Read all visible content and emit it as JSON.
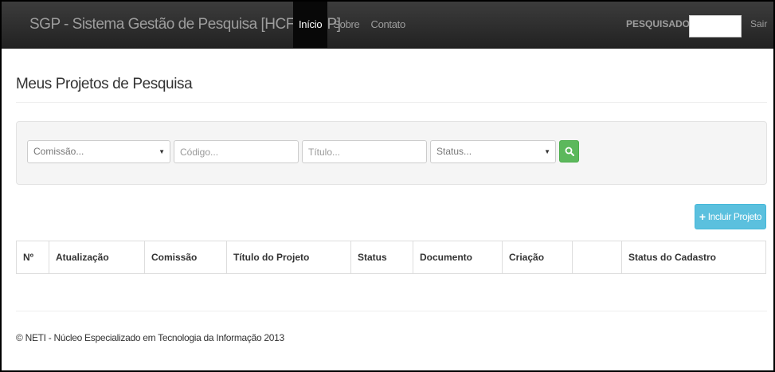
{
  "navbar": {
    "brand": "SGP - Sistema Gestão de Pesquisa [HCFMUSP]",
    "links": [
      {
        "label": "Início",
        "active": true
      },
      {
        "label": "Sobre",
        "active": false
      },
      {
        "label": "Contato",
        "active": false
      }
    ],
    "user_label": "PESQUISADOR |",
    "user_name": "",
    "logout_label": "Sair"
  },
  "page": {
    "title": "Meus Projetos de Pesquisa"
  },
  "filters": {
    "comissao": {
      "value": "Comissão..."
    },
    "codigo": {
      "placeholder": "Código..."
    },
    "titulo": {
      "placeholder": "Título..."
    },
    "status": {
      "value": "Status..."
    },
    "search_icon": "search-icon"
  },
  "actions": {
    "include_label": "Incluir Projeto",
    "include_icon": "plus-icon"
  },
  "table": {
    "columns": [
      "Nº",
      "Atualização",
      "Comissão",
      "Título do Projeto",
      "Status",
      "Documento",
      "Criação",
      "",
      "Status do Cadastro"
    ],
    "rows": []
  },
  "footer": {
    "text": "© NETI - Núcleo Especializado em Tecnologia da Informação 2013"
  },
  "colors": {
    "navbar_bg": "#222222",
    "search_button": "#5cb85c",
    "include_button": "#5bc0de"
  }
}
